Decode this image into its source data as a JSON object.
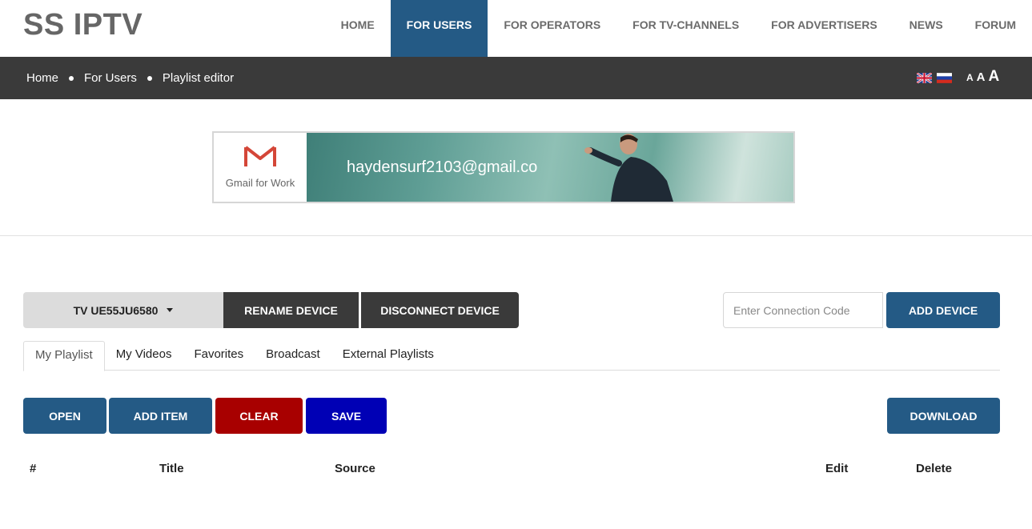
{
  "header": {
    "logo": "SS IPTV",
    "nav": [
      {
        "label": "HOME",
        "active": false
      },
      {
        "label": "FOR USERS",
        "active": true
      },
      {
        "label": "FOR OPERATORS",
        "active": false
      },
      {
        "label": "FOR TV-CHANNELS",
        "active": false
      },
      {
        "label": "FOR ADVERTISERS",
        "active": false
      },
      {
        "label": "NEWS",
        "active": false
      },
      {
        "label": "FORUM",
        "active": false
      }
    ]
  },
  "breadcrumb": [
    "Home",
    "For Users",
    "Playlist editor"
  ],
  "languages": {
    "en": "english-flag-icon",
    "ru": "russian-flag-icon"
  },
  "font_size_controls": [
    "A",
    "A",
    "A"
  ],
  "ad": {
    "brand": "Gmail for Work",
    "email": "haydensurf2103@gmail.co"
  },
  "device": {
    "selected": "TV UE55JU6580",
    "rename_label": "RENAME DEVICE",
    "disconnect_label": "DISCONNECT DEVICE",
    "code_placeholder": "Enter Connection Code",
    "add_label": "ADD DEVICE"
  },
  "tabs": [
    {
      "label": "My Playlist",
      "active": true
    },
    {
      "label": "My Videos",
      "active": false
    },
    {
      "label": "Favorites",
      "active": false
    },
    {
      "label": "Broadcast",
      "active": false
    },
    {
      "label": "External Playlists",
      "active": false
    }
  ],
  "actions": {
    "open": "OPEN",
    "add_item": "ADD ITEM",
    "clear": "CLEAR",
    "save": "SAVE",
    "download": "DOWNLOAD"
  },
  "table": {
    "columns": [
      "#",
      "Title",
      "Source",
      "Edit",
      "Delete"
    ]
  },
  "colors": {
    "accent": "#245a85",
    "dark": "#3a3a3a",
    "clear": "#a80000",
    "save": "#0000b5"
  }
}
